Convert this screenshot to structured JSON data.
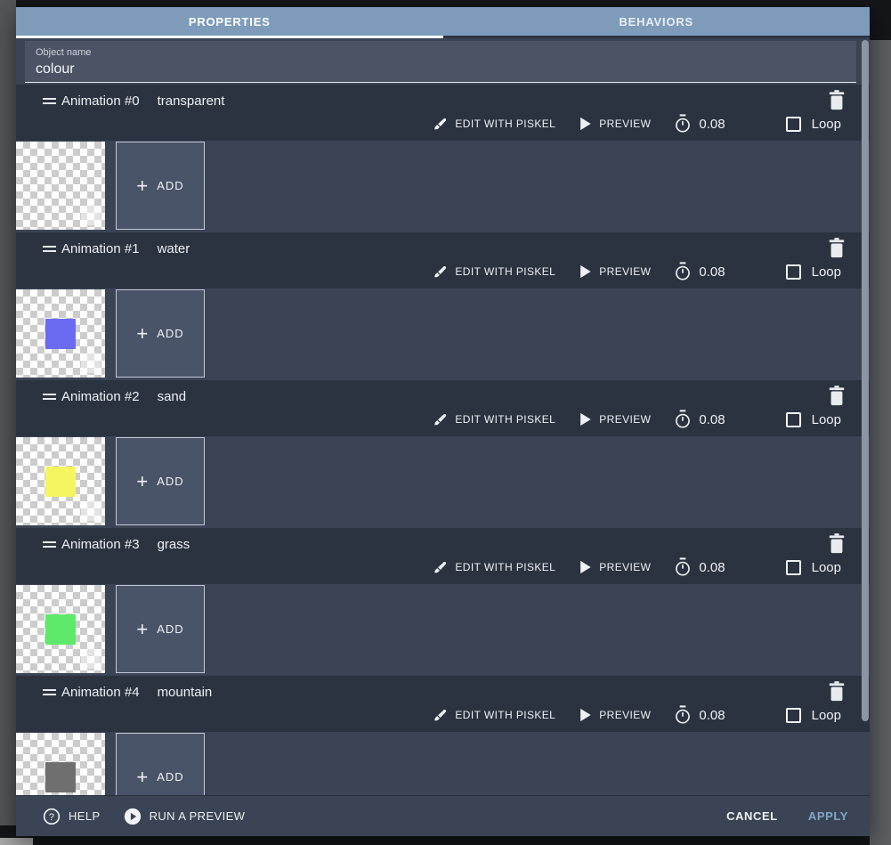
{
  "dialog": {
    "tabs": [
      {
        "label": "PROPERTIES",
        "active": true
      },
      {
        "label": "BEHAVIORS",
        "active": false
      }
    ],
    "object_name": {
      "label": "Object name",
      "value": "colour"
    },
    "animations": [
      {
        "title": "Animation #0",
        "name": "transparent",
        "frame_color": null
      },
      {
        "title": "Animation #1",
        "name": "water",
        "frame_color": "#6a6af2"
      },
      {
        "title": "Animation #2",
        "name": "sand",
        "frame_color": "#f5f562"
      },
      {
        "title": "Animation #3",
        "name": "grass",
        "frame_color": "#5fe96a"
      },
      {
        "title": "Animation #4",
        "name": "mountain",
        "frame_color": "#6f6f6f"
      }
    ],
    "animation_controls": {
      "edit_label": "EDIT WITH PISKEL",
      "preview_label": "PREVIEW",
      "time_between_frames": "0.08",
      "loop_label": "Loop",
      "loop_checked": false,
      "add_label": "ADD",
      "add_plus": "+"
    },
    "footer": {
      "help_label": "HELP",
      "run_preview_label": "RUN A PREVIEW",
      "cancel_label": "CANCEL",
      "apply_label": "APPLY"
    },
    "colors": {
      "tab_bar": "#7e9cba",
      "header_bg": "#2b3341",
      "row_bg": "#3b4454",
      "object_panel_bg": "#4c5364",
      "apply_text": "#7fa7c8",
      "frame_water": "#6a6af2",
      "frame_sand": "#f5f562",
      "frame_grass": "#5fe96a",
      "frame_mountain": "#6f6f6f"
    }
  }
}
